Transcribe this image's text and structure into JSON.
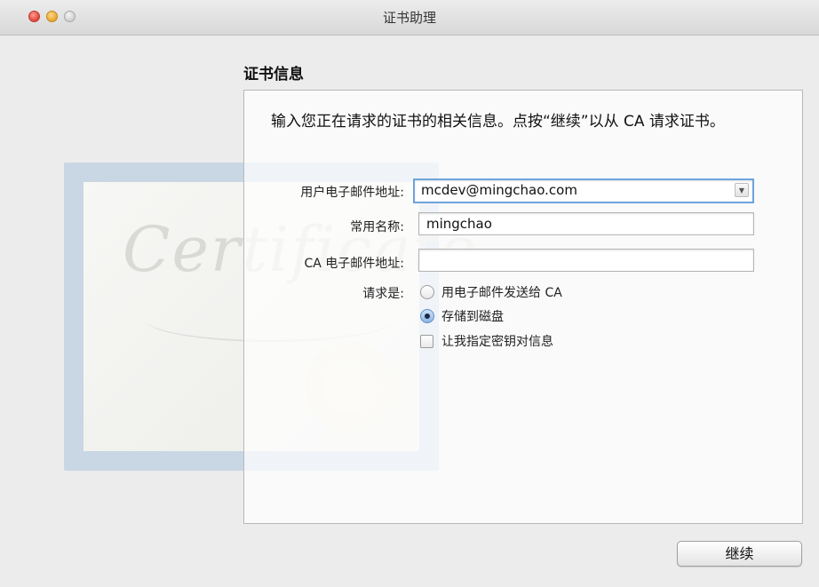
{
  "window": {
    "title": "证书助理"
  },
  "section": {
    "title": "证书信息"
  },
  "intro": "输入您正在请求的证书的相关信息。点按“继续”以从 CA 请求证书。",
  "certificate_art": {
    "script_text": "Certificate"
  },
  "form": {
    "email": {
      "label": "用户电子邮件地址:",
      "value": "mcdev@mingchao.com"
    },
    "common_name": {
      "label": "常用名称:",
      "value": "mingchao"
    },
    "ca_email": {
      "label": "CA 电子邮件地址:",
      "value": ""
    },
    "request": {
      "label": "请求是:",
      "options": [
        {
          "label": "用电子邮件发送给 CA",
          "selected": false
        },
        {
          "label": "存储到磁盘",
          "selected": true
        }
      ],
      "checkbox": {
        "label": "让我指定密钥对信息",
        "checked": false
      }
    }
  },
  "buttons": {
    "continue": "继续"
  },
  "colors": {
    "focus_ring": "#6ea3dc",
    "cert_border": "#c9d7e4"
  },
  "icons": {
    "close": "close-icon",
    "minimize": "minimize-icon",
    "zoom": "zoom-icon",
    "dropdown": "chevron-down-icon"
  }
}
